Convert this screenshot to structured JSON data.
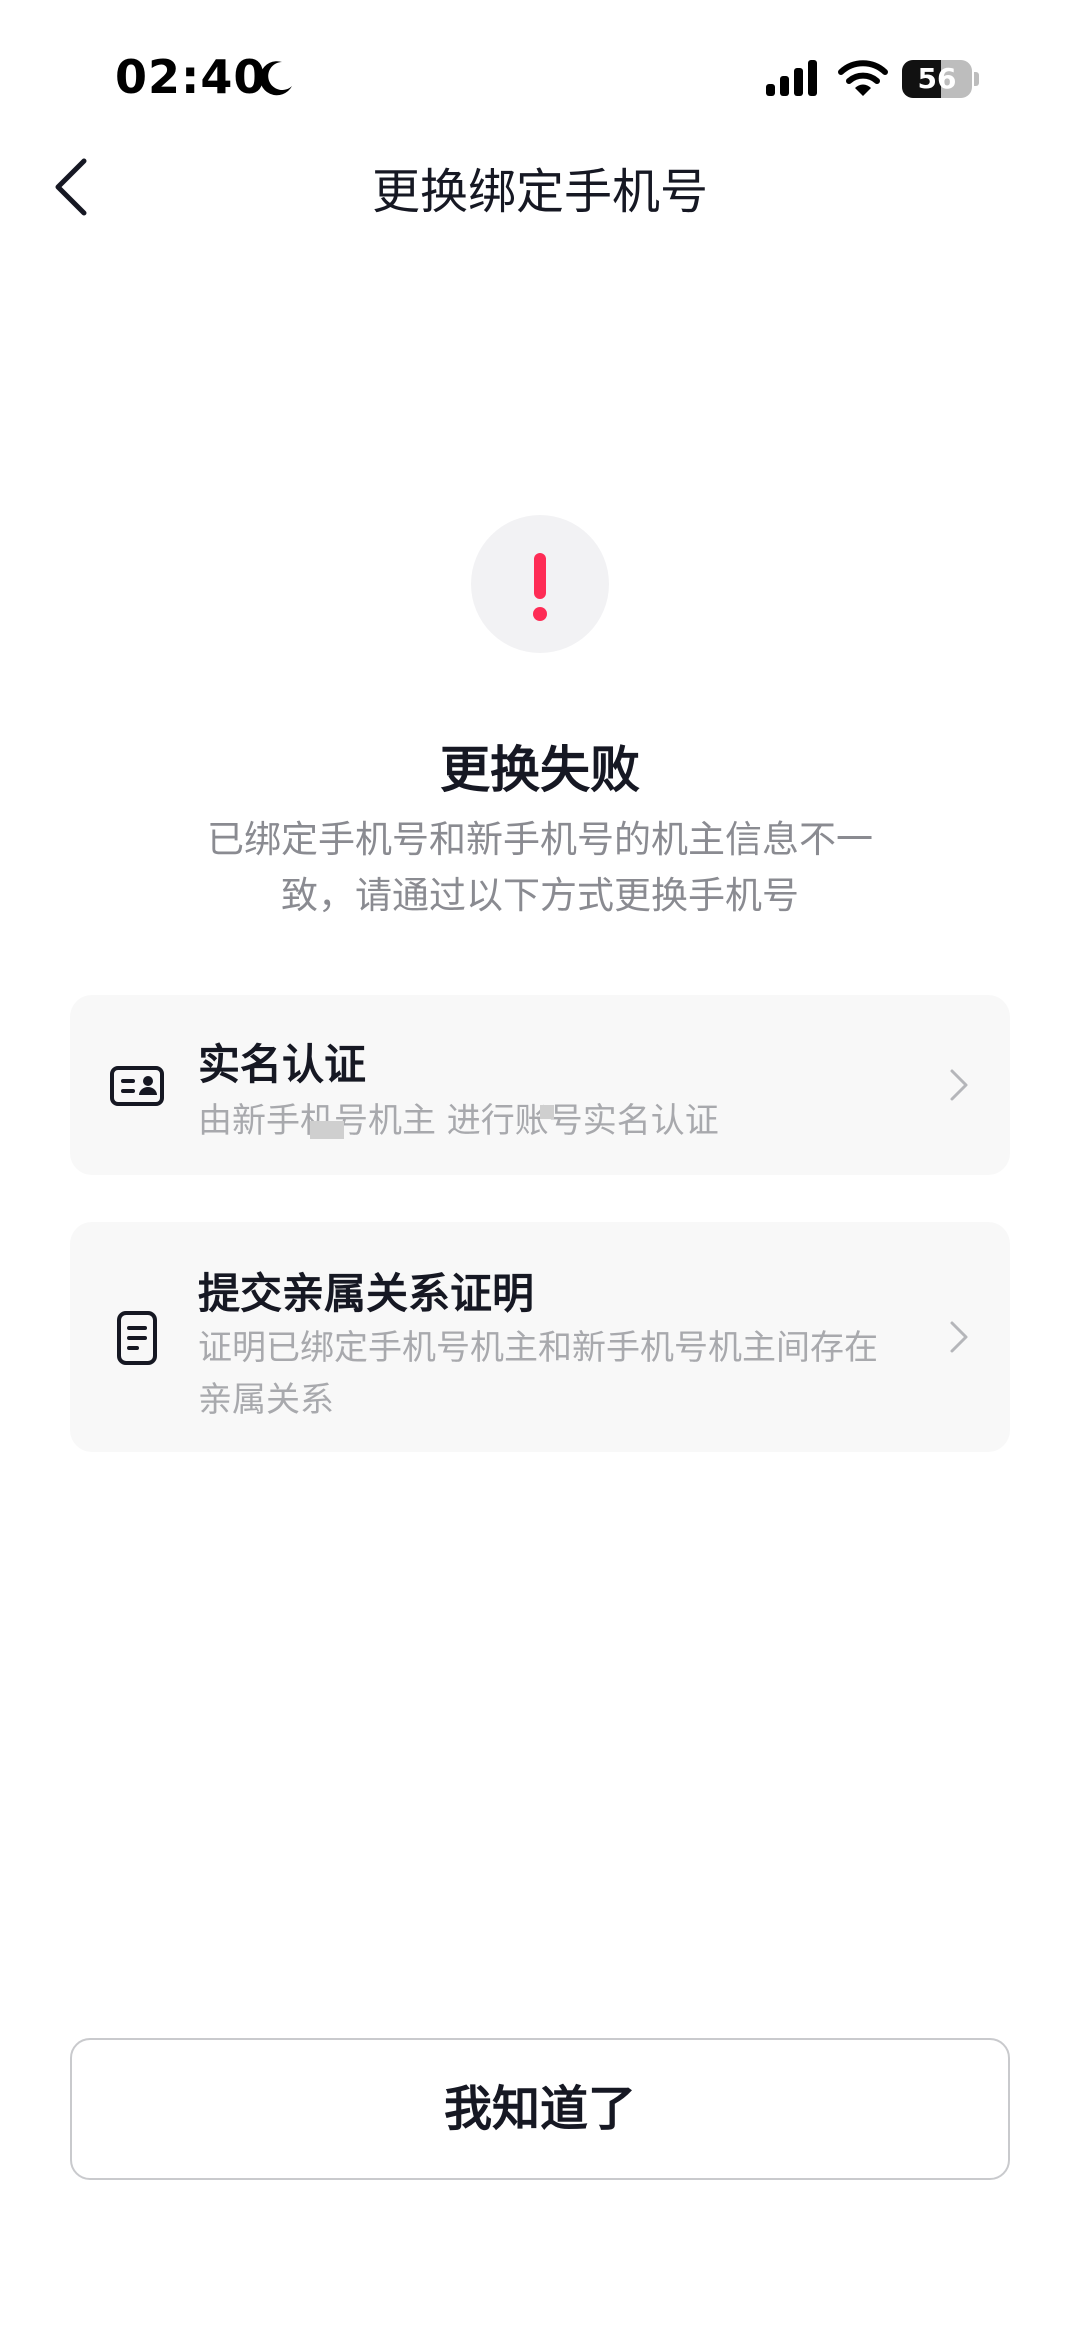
{
  "status_bar": {
    "time": "02:40",
    "battery_level": "56",
    "battery_fraction": 0.56,
    "icons": [
      "moon-icon",
      "signal-icon",
      "wifi-icon",
      "battery-icon"
    ]
  },
  "nav": {
    "back_icon": "chevron-left-icon",
    "title": "更换绑定手机号"
  },
  "result": {
    "icon": "exclamation-icon",
    "accent_color": "#fe2c55",
    "title": "更换失败",
    "description": "已绑定手机号和新手机号的机主信息不一致，请通过以下方式更换手机号"
  },
  "options": [
    {
      "icon": "id-card-icon",
      "title": "实名认证",
      "description": "由新手机号机主 进行账号实名认证"
    },
    {
      "icon": "document-icon",
      "title": "提交亲属关系证明",
      "description": "证明已绑定手机号机主和新手机号机主间存在亲属关系"
    }
  ],
  "footer": {
    "button_label": "我知道了"
  }
}
